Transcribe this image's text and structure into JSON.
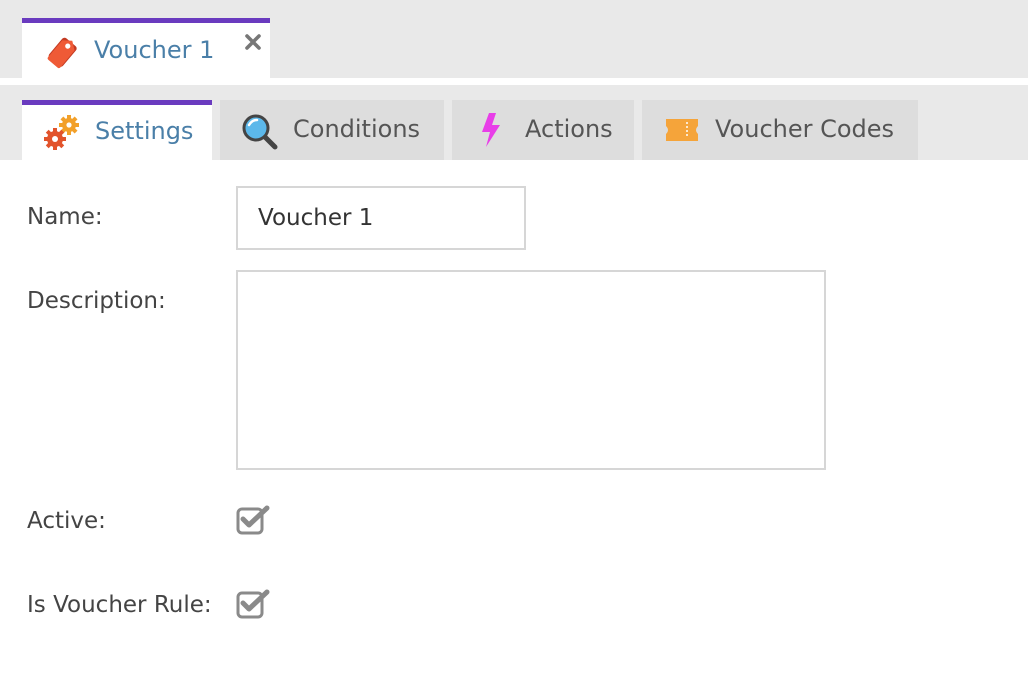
{
  "document_tab": {
    "title": "Voucher 1",
    "icon": "price-tag-icon",
    "close_icon": "close-icon"
  },
  "tabs": [
    {
      "label": "Settings",
      "icon": "gears-icon",
      "active": true
    },
    {
      "label": "Conditions",
      "icon": "magnifier-icon",
      "active": false
    },
    {
      "label": "Actions",
      "icon": "lightning-icon",
      "active": false
    },
    {
      "label": "Voucher Codes",
      "icon": "ticket-icon",
      "active": false
    }
  ],
  "form": {
    "name_label": "Name:",
    "name_value": "Voucher 1",
    "description_label": "Description:",
    "description_value": "",
    "active_label": "Active:",
    "active_checked": true,
    "voucher_rule_label": "Is Voucher Rule:",
    "voucher_rule_checked": true
  },
  "colors": {
    "accent": "#6a3bbf",
    "tab_text_active": "#4a7fa8",
    "tag_icon": "#e8452c",
    "gear_orange": "#f2a02a",
    "gear_red": "#e2532b",
    "lightning": "#e83ee8",
    "ticket": "#f5a43a"
  }
}
